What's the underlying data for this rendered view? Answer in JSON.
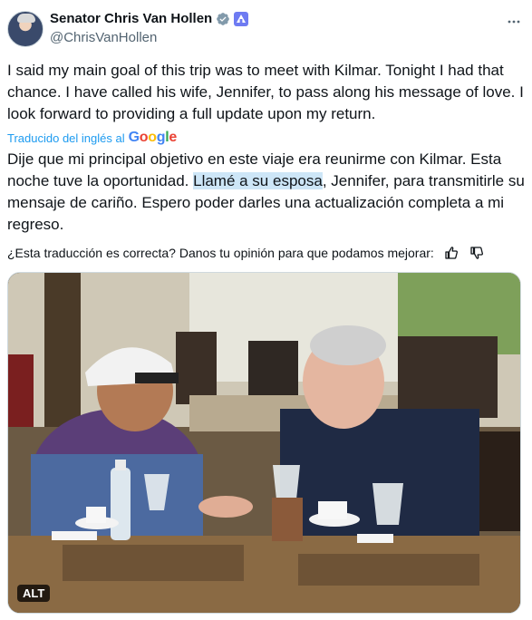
{
  "author": {
    "name": "Senator Chris Van Hollen",
    "handle": "@ChrisVanHollen",
    "avatar_icon": "profile-avatar",
    "verified_icon": "verified-badge-icon",
    "affiliate_icon": "government-affiliate-badge-icon"
  },
  "tweet": {
    "text": "I said my main goal of this trip was to meet with Kilmar. Tonight I had that chance. I have called his wife, Jennifer, to pass along his message of love. I look forward to providing a full update upon my return."
  },
  "translation": {
    "label": "Traducido del inglés al",
    "provider": "Google",
    "text_before": "Dije que mi principal objetivo en este viaje era reunirme con Kilmar. Esta noche tuve la oportunidad. ",
    "text_highlight": "Llamé a su esposa",
    "text_after": ", Jennifer, para transmitirle su mensaje de cariño. Espero poder darles una actualización completa a mi regreso."
  },
  "feedback": {
    "question": "¿Esta traducción es correcta? Danos tu opinión para que podamos mejorar:",
    "like_icon": "thumbs-up-icon",
    "dislike_icon": "thumbs-down-icon"
  },
  "media": {
    "alt_label": "ALT"
  },
  "colors": {
    "accent": "#1d9bf0",
    "text": "#0f1419",
    "secondary": "#536471",
    "highlight": "#cde6f7"
  }
}
